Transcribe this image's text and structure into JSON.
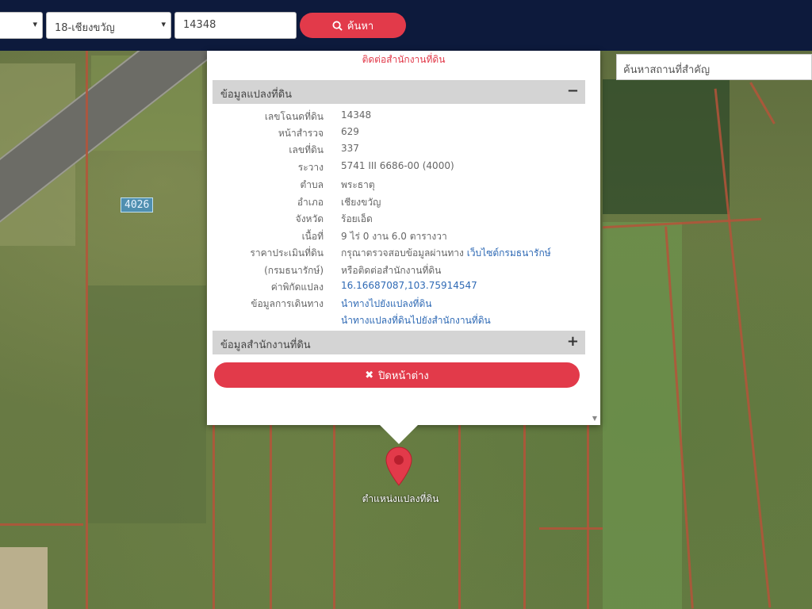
{
  "toolbar": {
    "province_select": {
      "value": ""
    },
    "district_select": {
      "value": "18-เชียงขวัญ"
    },
    "parcel_input": {
      "value": "14348"
    },
    "search_button": "ค้นหา"
  },
  "map": {
    "road_number": "4026",
    "place_search": {
      "placeholder": "ค้นหาสถานที่สำคัญ"
    },
    "marker_label": "ตำแหน่งแปลงที่ดิน"
  },
  "popup": {
    "top_link": "ติดต่อสำนักงานที่ดิน",
    "section_parcel": "ข้อมูลแปลงที่ดิน",
    "section_parcel_toggle": "−",
    "rows": [
      {
        "label": "เลขโฉนดที่ดิน",
        "value": "14348"
      },
      {
        "label": "หน้าสำรวจ",
        "value": "629"
      },
      {
        "label": "เลขที่ดิน",
        "value": "337"
      },
      {
        "label": "ระวาง",
        "value": "5741 III 6686-00 (4000)"
      },
      {
        "label": "ตำบล",
        "value": "พระธาตุ"
      },
      {
        "label": "อำเภอ",
        "value": "เชียงขวัญ"
      },
      {
        "label": "จังหวัด",
        "value": "ร้อยเอ็ด"
      },
      {
        "label": "เนื้อที่",
        "value": "9 ไร่ 0 งาน 6.0 ตารางวา"
      },
      {
        "label": "ราคาประเมินที่ดิน",
        "value": "กรุณาตรวจสอบข้อมูลผ่านทาง ",
        "link": "เว็บไซต์กรมธนารักษ์"
      },
      {
        "label": "(กรมธนารักษ์)",
        "value": "หรือติดต่อสำนักงานที่ดิน"
      },
      {
        "label": "ค่าพิกัดแปลง",
        "value": "16.16687087,103.75914547",
        "is_link": true
      },
      {
        "label": "ข้อมูลการเดินทาง",
        "value": "นำทางไปยังแปลงที่ดิน",
        "is_link": true
      },
      {
        "label": "",
        "value": "นำทางแปลงที่ดินไปยังสำนักงานที่ดิน",
        "is_link": true
      }
    ],
    "section_office": "ข้อมูลสำนักงานที่ดิน",
    "section_office_toggle": "+",
    "close_button": "ปิดหน้าต่าง"
  },
  "colors": {
    "navbar": "#0d1a3c",
    "accent": "#e23a4a",
    "link": "#2f6ab5"
  }
}
